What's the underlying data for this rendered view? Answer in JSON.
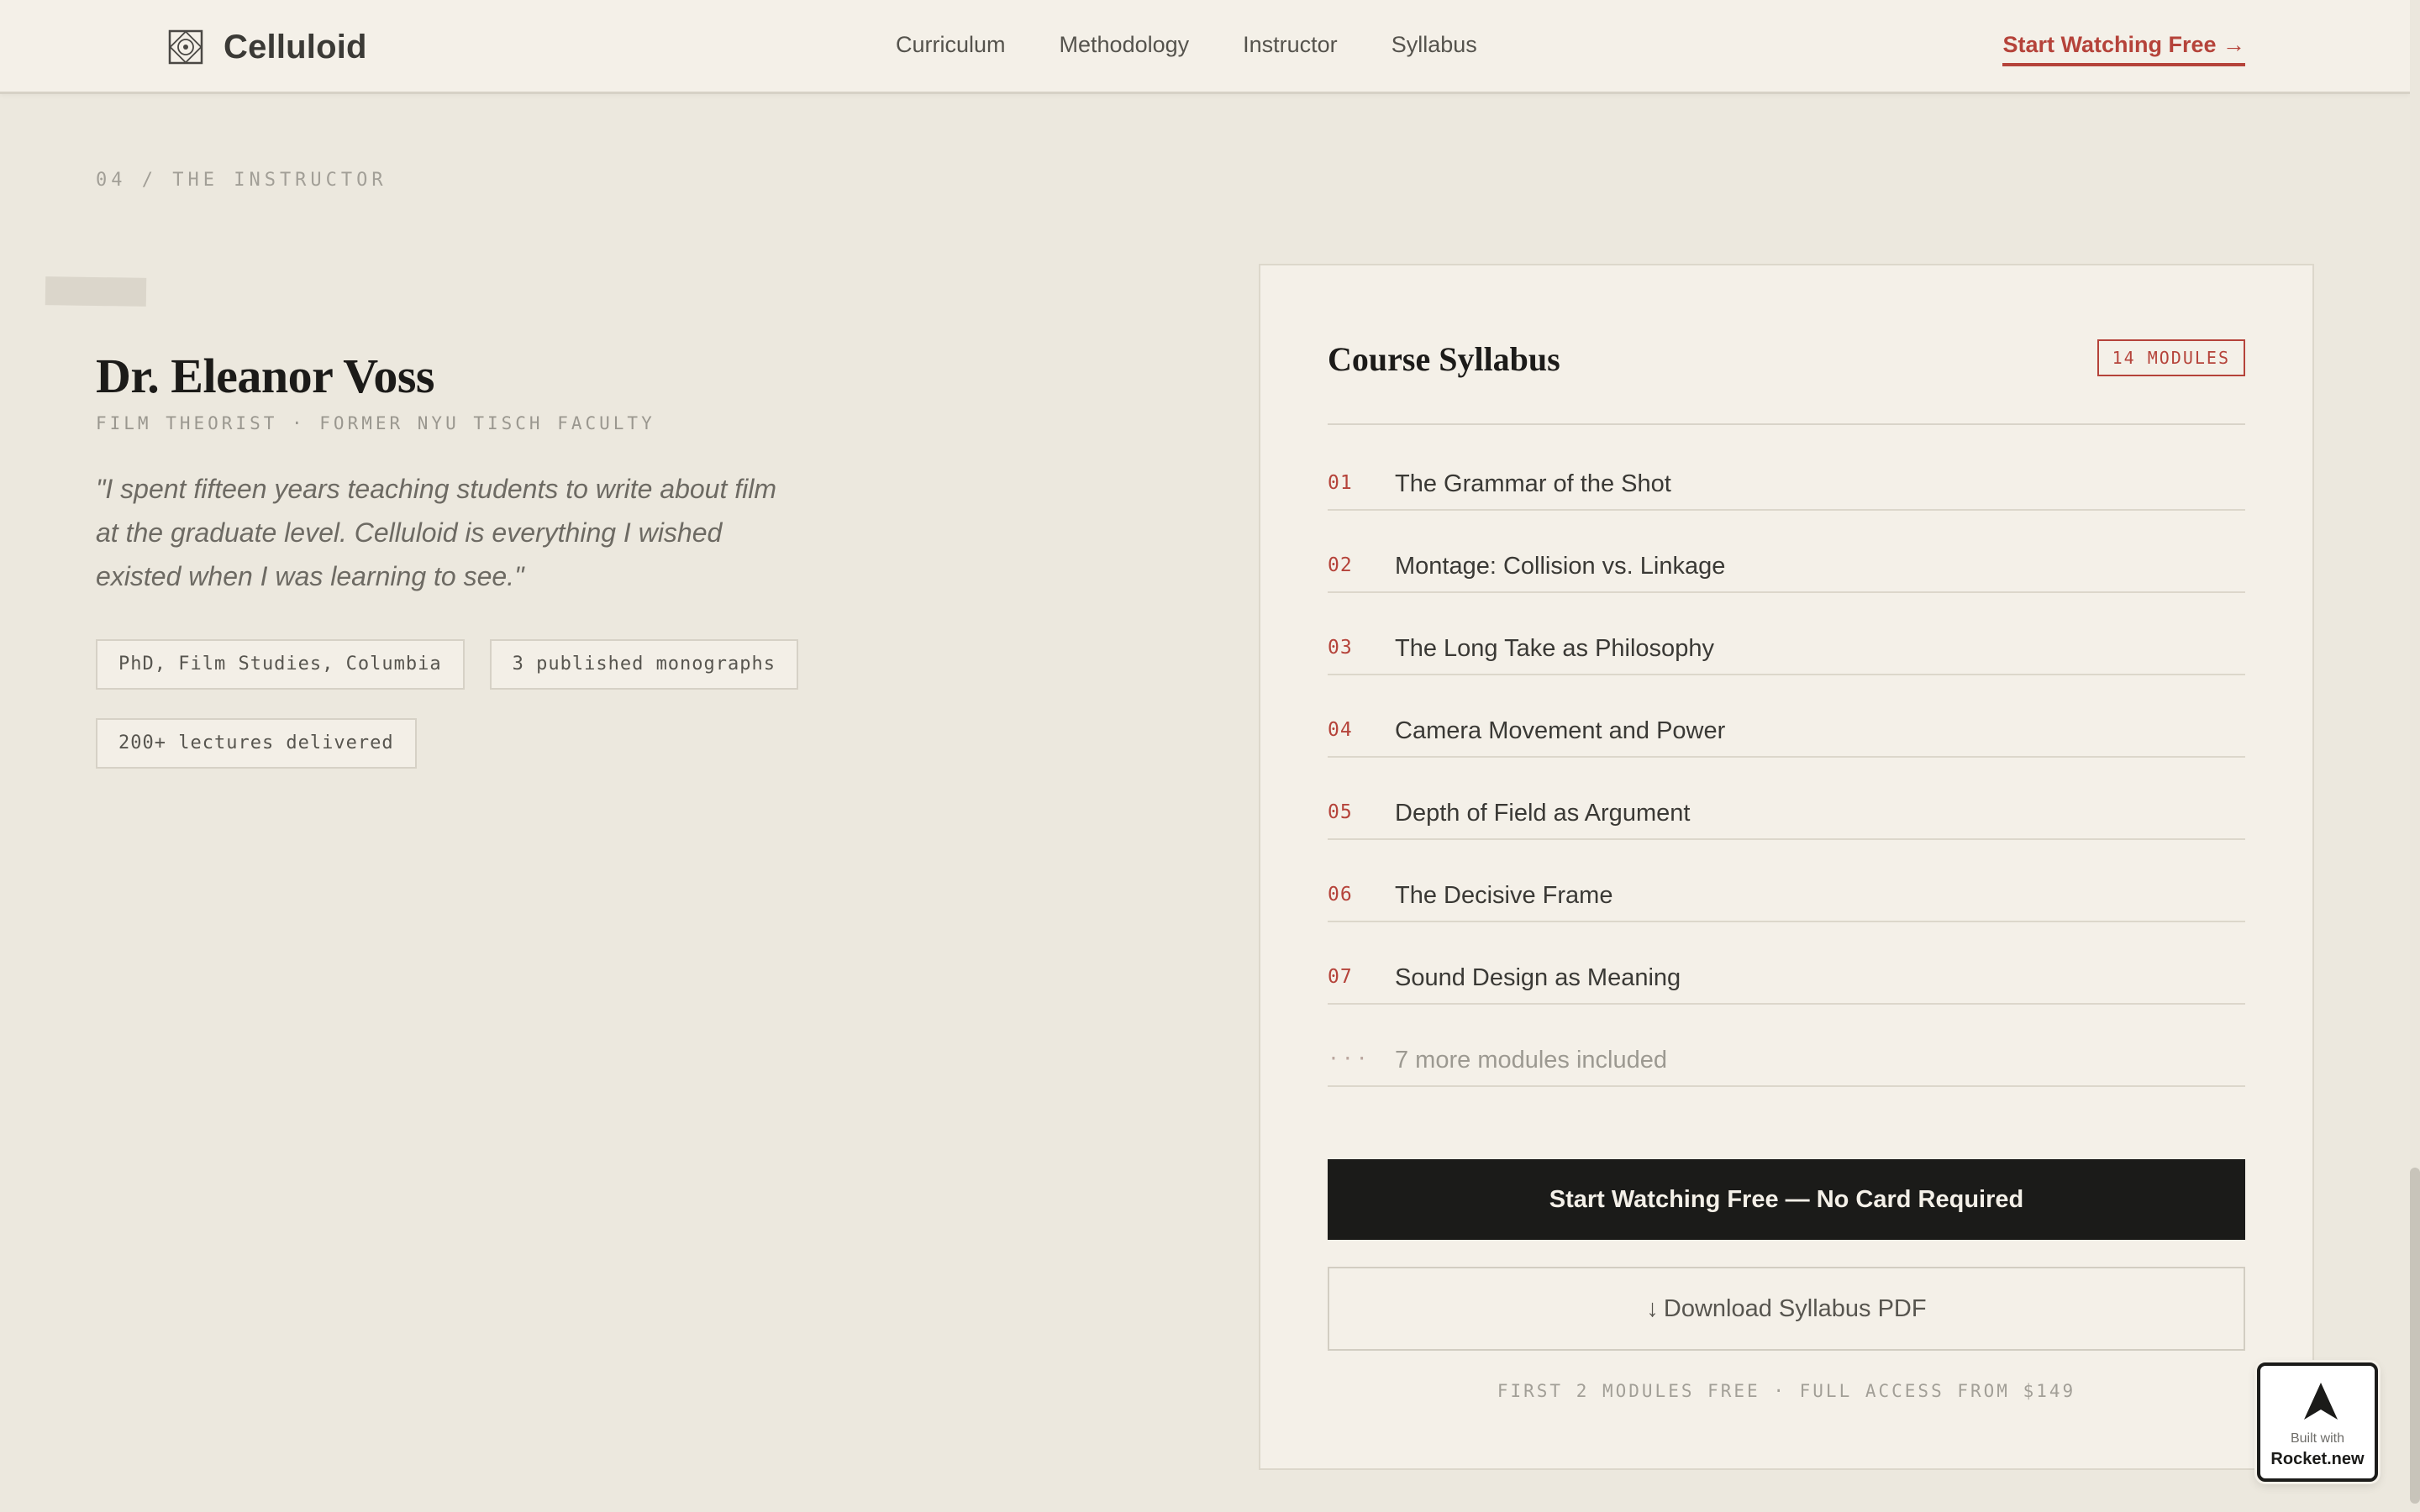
{
  "nav": {
    "brand": "Celluloid",
    "links": [
      "Curriculum",
      "Methodology",
      "Instructor",
      "Syllabus"
    ],
    "cta": "Start Watching Free →"
  },
  "instructor": {
    "section_label": "04 / THE INSTRUCTOR",
    "name": "Dr. Eleanor Voss",
    "role": "FILM THEORIST · FORMER NYU TISCH FACULTY",
    "quote": "\"I spent fifteen years teaching students to write about film at the graduate level. Celluloid is everything I wished existed when I was learning to see.\"",
    "credentials": [
      "PhD, Film Studies, Columbia",
      "3 published monographs",
      "200+ lectures delivered"
    ]
  },
  "syllabus": {
    "title": "Course Syllabus",
    "badge": "14 MODULES",
    "modules": [
      {
        "num": "01",
        "title": "The Grammar of the Shot"
      },
      {
        "num": "02",
        "title": "Montage: Collision vs. Linkage"
      },
      {
        "num": "03",
        "title": "The Long Take as Philosophy"
      },
      {
        "num": "04",
        "title": "Camera Movement and Power"
      },
      {
        "num": "05",
        "title": "Depth of Field as Argument"
      },
      {
        "num": "06",
        "title": "The Decisive Frame"
      },
      {
        "num": "07",
        "title": "Sound Design as Meaning"
      }
    ],
    "more": {
      "num": "···",
      "title": "7 more modules included"
    },
    "primary_button": "Start Watching Free — No Card Required",
    "secondary_button": "Download Syllabus PDF",
    "secondary_icon": "↓",
    "footnote": "FIRST 2 MODULES FREE · FULL ACCESS FROM $149"
  },
  "badge": {
    "line1": "Built with",
    "line2": "Rocket.new",
    "icon": "rocket-icon"
  },
  "colors": {
    "accent": "#b5433a",
    "background": "#ece8de",
    "card": "#f4f0e8",
    "ink": "#1b1b19"
  }
}
